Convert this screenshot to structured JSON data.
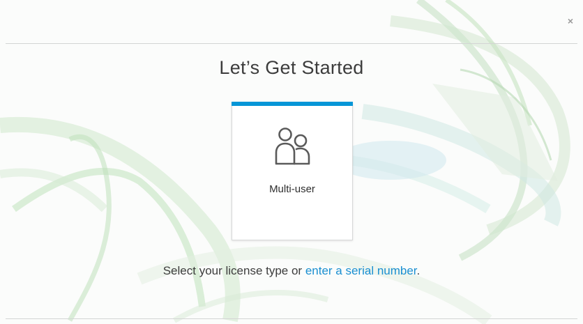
{
  "window": {
    "close_icon": "close-icon",
    "close_glyph": "×"
  },
  "header": {
    "title": "Let’s Get Started"
  },
  "license_options": [
    {
      "label": "Multi-user",
      "icon": "multi-user-icon",
      "accent_color": "#0696d7"
    }
  ],
  "footer": {
    "prompt_prefix": "Select your license type or ",
    "link_text": "enter a serial number",
    "prompt_suffix": ".",
    "link_color": "#1a8fd1"
  }
}
